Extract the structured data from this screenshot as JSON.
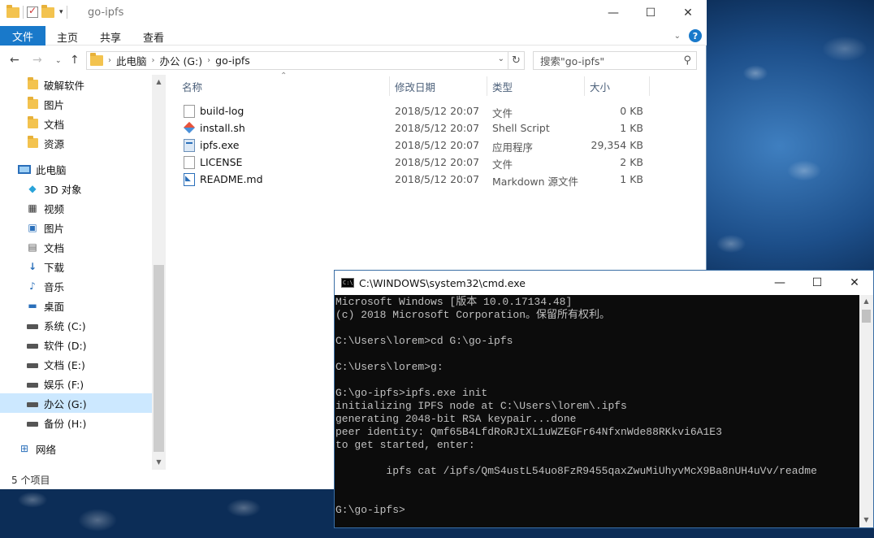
{
  "explorer": {
    "title": "go-ipfs",
    "ribbon_tabs": [
      "文件",
      "主页",
      "共享",
      "查看"
    ],
    "breadcrumb": [
      "此电脑",
      "办公 (G:)",
      "go-ipfs"
    ],
    "search_placeholder": "搜索\"go-ipfs\"",
    "nav_items": [
      {
        "label": "破解软件",
        "icon": "folder-icon"
      },
      {
        "label": "图片",
        "icon": "folder-icon"
      },
      {
        "label": "文档",
        "icon": "folder-icon"
      },
      {
        "label": "资源",
        "icon": "folder-icon"
      },
      {
        "label": "此电脑",
        "icon": "computer-icon"
      },
      {
        "label": "3D 对象",
        "icon": "3d-objects-icon"
      },
      {
        "label": "视频",
        "icon": "video-icon"
      },
      {
        "label": "图片",
        "icon": "pictures-icon"
      },
      {
        "label": "文档",
        "icon": "documents-icon"
      },
      {
        "label": "下载",
        "icon": "download-icon"
      },
      {
        "label": "音乐",
        "icon": "music-icon"
      },
      {
        "label": "桌面",
        "icon": "desktop-icon"
      },
      {
        "label": "系统 (C:)",
        "icon": "drive-icon"
      },
      {
        "label": "软件 (D:)",
        "icon": "drive-icon"
      },
      {
        "label": "文档 (E:)",
        "icon": "drive-icon"
      },
      {
        "label": "娱乐 (F:)",
        "icon": "drive-icon"
      },
      {
        "label": "办公 (G:)",
        "icon": "drive-icon"
      },
      {
        "label": "备份 (H:)",
        "icon": "drive-icon"
      },
      {
        "label": "网络",
        "icon": "network-icon"
      }
    ],
    "columns": [
      "名称",
      "修改日期",
      "类型",
      "大小"
    ],
    "files": [
      {
        "name": "build-log",
        "date": "2018/5/12 20:07",
        "type": "文件",
        "size": "0 KB",
        "icon": "file-icon"
      },
      {
        "name": "install.sh",
        "date": "2018/5/12 20:07",
        "type": "Shell Script",
        "size": "1 KB",
        "icon": "shell-script-icon"
      },
      {
        "name": "ipfs.exe",
        "date": "2018/5/12 20:07",
        "type": "应用程序",
        "size": "29,354 KB",
        "icon": "exe-icon"
      },
      {
        "name": "LICENSE",
        "date": "2018/5/12 20:07",
        "type": "文件",
        "size": "2 KB",
        "icon": "file-icon"
      },
      {
        "name": "README.md",
        "date": "2018/5/12 20:07",
        "type": "Markdown 源文件",
        "size": "1 KB",
        "icon": "markdown-icon"
      }
    ],
    "status": "5 个项目"
  },
  "cmd": {
    "title": "C:\\WINDOWS\\system32\\cmd.exe",
    "output": "Microsoft Windows [版本 10.0.17134.48]\n(c) 2018 Microsoft Corporation。保留所有权利。\n\nC:\\Users\\lorem>cd G:\\go-ipfs\n\nC:\\Users\\lorem>g:\n\nG:\\go-ipfs>ipfs.exe init\ninitializing IPFS node at C:\\Users\\lorem\\.ipfs\ngenerating 2048-bit RSA keypair...done\npeer identity: Qmf65B4LfdRoRJtXL1uWZEGFr64NfxnWde88RKkvi6A1E3\nto get started, enter:\n\n        ipfs cat /ipfs/QmS4ustL54uo8FzR9455qaxZwuMiUhyvMcX9Ba8nUH4uVv/readme\n\n\nG:\\go-ipfs>"
  }
}
